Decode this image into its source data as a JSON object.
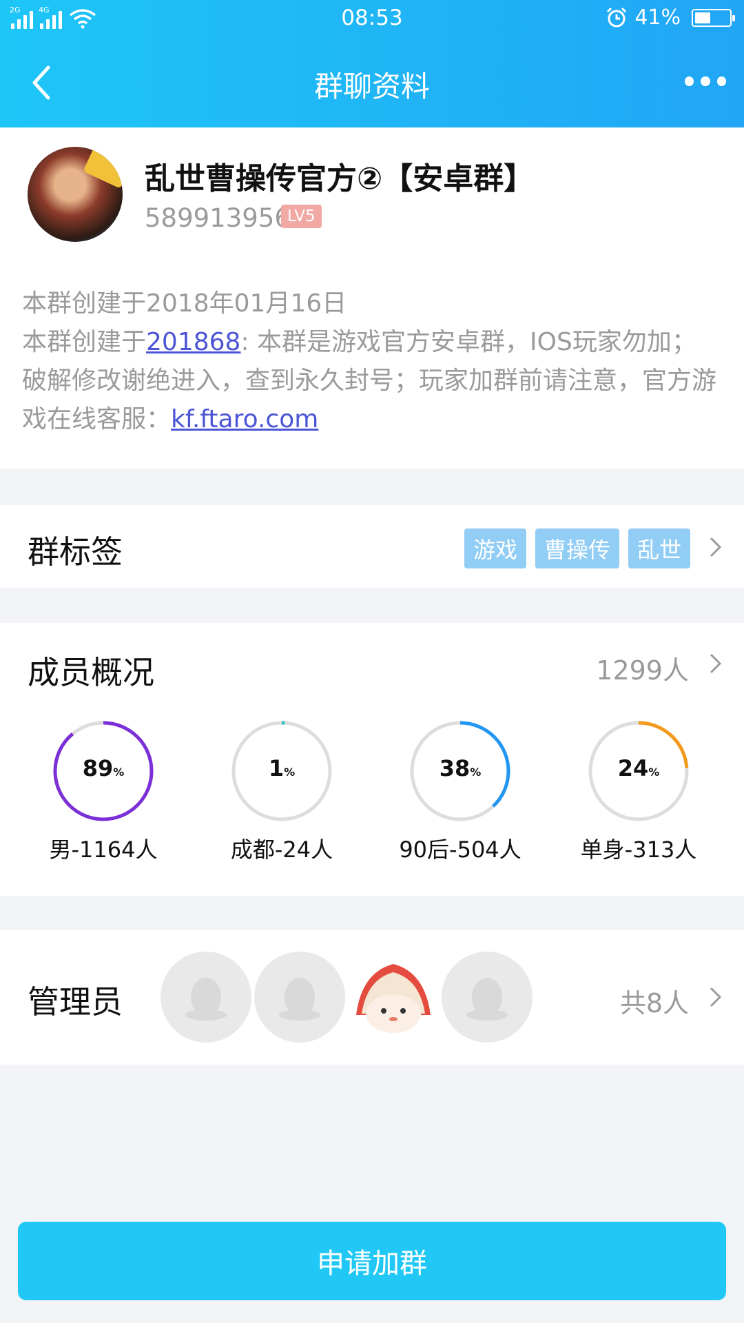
{
  "status_bar": {
    "time": "08:53",
    "signal_left": "2G",
    "signal_right": "4G",
    "battery_percent": "41%",
    "battery_level": 0.41
  },
  "nav": {
    "title": "群聊资料"
  },
  "group": {
    "name": "乱世曹操传官方②【安卓群】",
    "id": "589913956",
    "level": "LV5",
    "created": "本群创建于2018年01月16日",
    "desc_prefix": "本群创建于",
    "desc_link": "201868",
    "desc_body": ": 本群是游戏官方安卓群，IOS玩家勿加；破解修改谢绝进入，查到永久封号；玩家加群前请注意，官方游戏在线客服：",
    "desc_url": "kf.ftaro.com"
  },
  "tags": {
    "title": "群标签",
    "items": [
      "游戏",
      "曹操传",
      "乱世"
    ]
  },
  "members": {
    "title": "成员概况",
    "count": "1299人",
    "stats": [
      {
        "pct": "89",
        "unit": "%",
        "value": 0.89,
        "label": "男-1164人",
        "color": "#7b2fd6"
      },
      {
        "pct": "1",
        "unit": "%",
        "value": 0.01,
        "label": "成都-24人",
        "color": "#2bc1c9"
      },
      {
        "pct": "38",
        "unit": "%",
        "value": 0.38,
        "label": "90后-504人",
        "color": "#2196f3"
      },
      {
        "pct": "24",
        "unit": "%",
        "value": 0.24,
        "label": "单身-313人",
        "color": "#f39a1e"
      }
    ]
  },
  "admins": {
    "title": "管理员",
    "count": "共8人"
  },
  "apply_button": "申请加群"
}
